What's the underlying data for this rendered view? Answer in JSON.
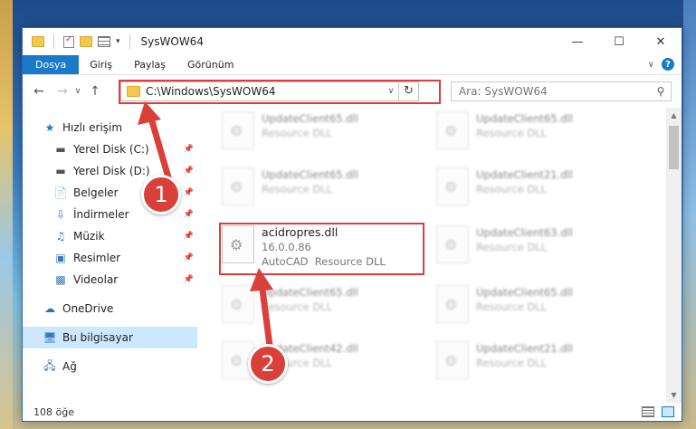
{
  "window": {
    "title": "SysWOW64"
  },
  "ribbon": {
    "tabs": [
      "Dosya",
      "Giriş",
      "Paylaş",
      "Görünüm"
    ]
  },
  "nav": {
    "address": "C:\\Windows\\SysWOW64",
    "search_placeholder": "Ara: SysWOW64"
  },
  "sidebar": {
    "items": [
      {
        "label": "Hızlı erişim",
        "icon": "star-icon"
      },
      {
        "label": "Yerel Disk (C:)",
        "icon": "drive-icon"
      },
      {
        "label": "Yerel Disk (D:)",
        "icon": "drive-icon"
      },
      {
        "label": "Belgeler",
        "icon": "documents-icon"
      },
      {
        "label": "İndirmeler",
        "icon": "download-icon"
      },
      {
        "label": "Müzik",
        "icon": "music-icon"
      },
      {
        "label": "Resimler",
        "icon": "pictures-icon"
      },
      {
        "label": "Videolar",
        "icon": "videos-icon"
      },
      {
        "label": "OneDrive",
        "icon": "cloud-icon"
      },
      {
        "label": "Bu bilgisayar",
        "icon": "computer-icon"
      },
      {
        "label": "Ağ",
        "icon": "network-icon"
      }
    ]
  },
  "files": {
    "focused": {
      "name": "acidropres.dll",
      "version": "16.0.0.86",
      "company": "AutoCAD",
      "type": "Resource DLL"
    },
    "left_col": [
      {
        "name": "UpdateClient65.dll",
        "type": "Resource DLL"
      },
      {
        "name": "UpdateClient65.dll",
        "type": "Resource DLL"
      },
      {
        "name": "UpdateClient65.dll",
        "type": "Resource DLL"
      },
      {
        "name": "UpdateClient42.dll",
        "type": "Resource DLL"
      }
    ],
    "right_col": [
      {
        "name": "UpdateClient65.dll",
        "type": "Resource DLL"
      },
      {
        "name": "UpdateClient21.dll",
        "type": "Resource DLL"
      },
      {
        "name": "UpdateClient63.dll",
        "type": "Resource DLL"
      },
      {
        "name": "UpdateClient65.dll",
        "type": "Resource DLL"
      },
      {
        "name": "UpdateClient21.dll",
        "type": "Resource DLL"
      }
    ]
  },
  "status": {
    "count": "108 öğe"
  },
  "annotations": {
    "step1": "1",
    "step2": "2",
    "color": "#d9403a"
  }
}
